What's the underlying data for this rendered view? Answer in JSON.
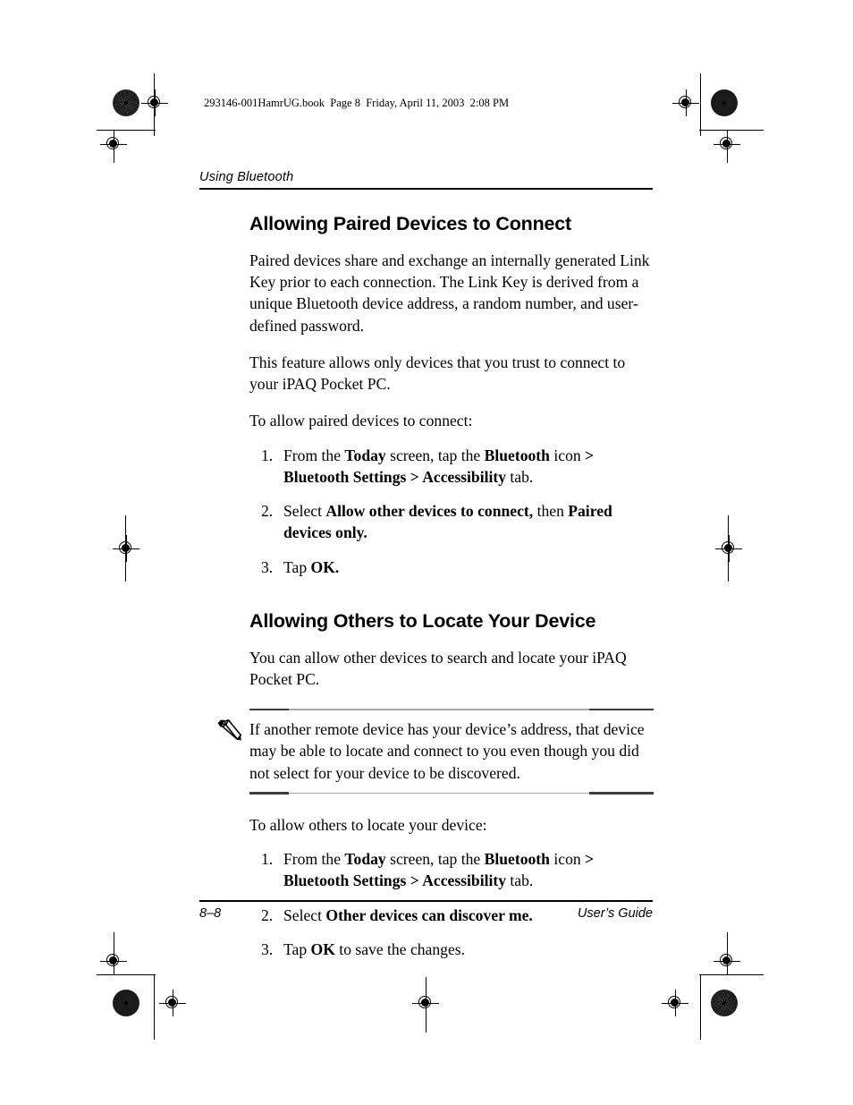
{
  "print_marks": {
    "book_stamp": "293146-001HamrUG.book  Page 8  Friday, April 11, 2003  2:08 PM"
  },
  "running_header": {
    "text": "Using Bluetooth"
  },
  "sections": [
    {
      "heading": "Allowing Paired Devices to Connect",
      "paragraphs": [
        "Paired devices share and exchange an internally generated Link Key prior to each connection. The Link Key is derived from a unique Bluetooth device address, a random number, and user-defined password.",
        "This feature allows only devices that you trust to connect to your iPAQ Pocket PC.",
        "To allow paired devices to connect:"
      ],
      "steps": [
        {
          "num": "1.",
          "parts": [
            {
              "t": "From the ",
              "b": false
            },
            {
              "t": "Today",
              "b": true
            },
            {
              "t": " screen, tap the ",
              "b": false
            },
            {
              "t": "Bluetooth",
              "b": true
            },
            {
              "t": " icon ",
              "b": false
            },
            {
              "t": "> Bluetooth Settings > Accessibility",
              "b": true
            },
            {
              "t": " tab.",
              "b": false
            }
          ]
        },
        {
          "num": "2.",
          "parts": [
            {
              "t": "Select ",
              "b": false
            },
            {
              "t": "Allow other devices to connect,",
              "b": true
            },
            {
              "t": " then ",
              "b": false
            },
            {
              "t": "Paired devices only.",
              "b": true
            }
          ]
        },
        {
          "num": "3.",
          "parts": [
            {
              "t": "Tap ",
              "b": false
            },
            {
              "t": "OK.",
              "b": true
            }
          ]
        }
      ]
    },
    {
      "heading": "Allowing Others to Locate Your Device",
      "paragraphs": [
        "You can allow other devices to search and locate your iPAQ Pocket PC."
      ],
      "note": {
        "icon": "pencil-icon",
        "text": "If another remote device has your device’s address, that device may be able to locate and connect to you even though you did not select for your device to be discovered."
      },
      "lead_in": "To allow others to locate your device:",
      "steps": [
        {
          "num": "1.",
          "parts": [
            {
              "t": "From the ",
              "b": false
            },
            {
              "t": "Today",
              "b": true
            },
            {
              "t": " screen, tap the ",
              "b": false
            },
            {
              "t": "Bluetooth",
              "b": true
            },
            {
              "t": " icon ",
              "b": false
            },
            {
              "t": "> Bluetooth Settings > Accessibility",
              "b": true
            },
            {
              "t": " tab.",
              "b": false
            }
          ]
        },
        {
          "num": "2.",
          "parts": [
            {
              "t": "Select ",
              "b": false
            },
            {
              "t": "Other devices can discover me.",
              "b": true
            }
          ]
        },
        {
          "num": "3.",
          "parts": [
            {
              "t": "Tap ",
              "b": false
            },
            {
              "t": "OK",
              "b": true
            },
            {
              "t": " to save the changes.",
              "b": false
            }
          ]
        }
      ]
    }
  ],
  "footer": {
    "page_number": "8–8",
    "guide_label": "User’s Guide"
  }
}
